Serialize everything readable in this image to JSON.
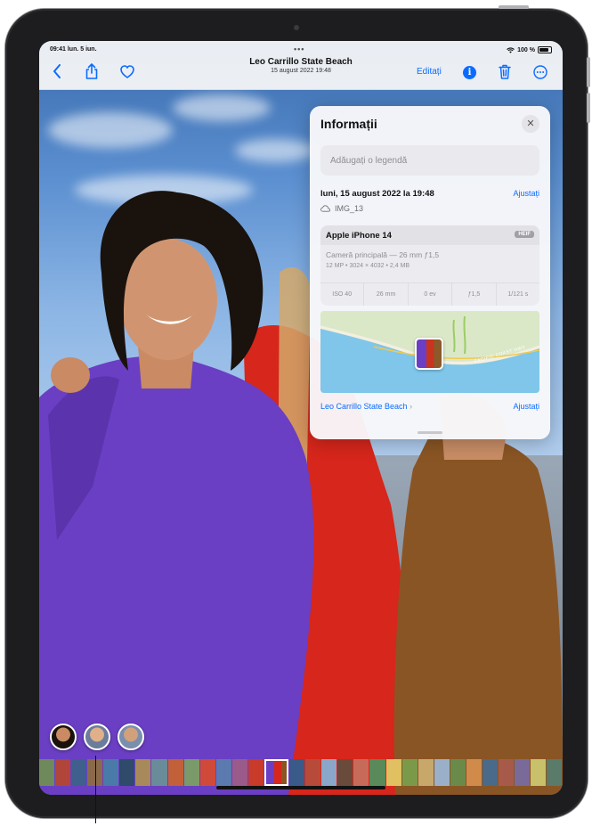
{
  "status_bar": {
    "time_date": "09:41 lun. 5 iun.",
    "battery": "100 %"
  },
  "nav": {
    "title": "Leo Carrillo State Beach",
    "subtitle": "15 august 2022 19:48",
    "edit_label": "Editați",
    "info_icon_glyph": "i",
    "icons": [
      "chevron-left-icon",
      "share-icon",
      "heart-icon",
      "info-icon",
      "trash-icon",
      "more-icon"
    ]
  },
  "info_panel": {
    "title": "Informații",
    "close_glyph": "✕",
    "caption_placeholder": "Adăugați o legendă",
    "date_time": "luni, 15 august 2022 la 19:48",
    "date_adjust_label": "Ajustați",
    "filename": "IMG_13",
    "device": {
      "name": "Apple iPhone 14",
      "format_badge": "HEIF",
      "lens": "Cameră principală — 26 mm ƒ1,5",
      "resolution": "12 MP • 3024 × 4032 • 2,4 MB",
      "specs": [
        "ISO 40",
        "26 mm",
        "0 ev",
        "ƒ1,5",
        "1/121 s"
      ]
    },
    "map": {
      "road_label": "PACIFIC COAST HWY"
    },
    "location": {
      "name": "Leo Carrillo State Beach",
      "adjust_label": "Ajustați"
    }
  },
  "colors": {
    "accent": "#0a6cff",
    "panel_bg": "#f8f8fa"
  }
}
